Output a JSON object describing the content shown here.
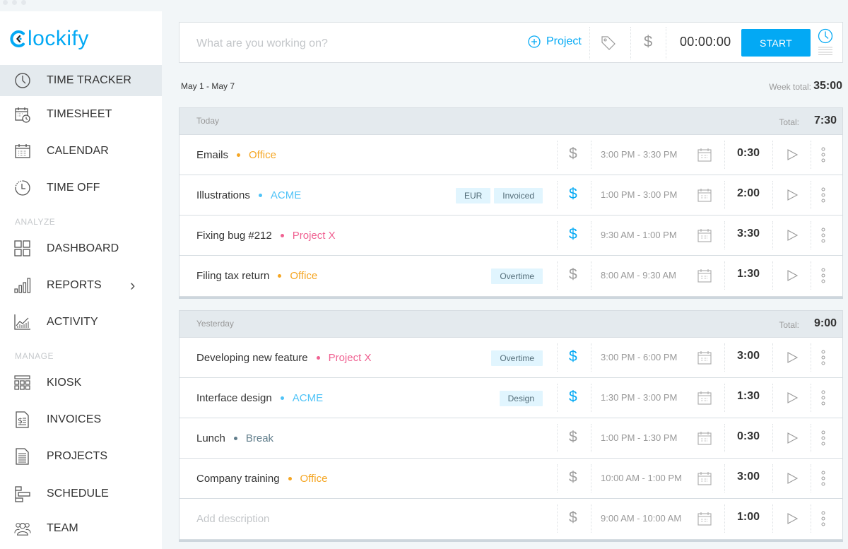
{
  "app": {
    "logo_text": "lockify",
    "brand_color": "#03a9f4"
  },
  "sidebar": {
    "items": [
      {
        "label": "TIME TRACKER",
        "icon": "clock-icon",
        "active": true
      },
      {
        "label": "TIMESHEET",
        "icon": "timesheet-icon"
      },
      {
        "label": "CALENDAR",
        "icon": "calendar-icon"
      },
      {
        "label": "TIME OFF",
        "icon": "time-off-icon"
      },
      {
        "label": "DASHBOARD",
        "icon": "dashboard-icon"
      },
      {
        "label": "REPORTS",
        "icon": "reports-icon",
        "has_submenu": true
      },
      {
        "label": "ACTIVITY",
        "icon": "activity-icon"
      },
      {
        "label": "KIOSK",
        "icon": "kiosk-icon"
      },
      {
        "label": "INVOICES",
        "icon": "invoice-icon"
      },
      {
        "label": "PROJECTS",
        "icon": "projects-icon"
      },
      {
        "label": "SCHEDULE",
        "icon": "schedule-icon"
      },
      {
        "label": "TEAM",
        "icon": "team-icon"
      }
    ],
    "sections": {
      "analyze": "ANALYZE",
      "manage": "MANAGE"
    },
    "reports_chevron": "›"
  },
  "tracker": {
    "placeholder": "What are you working on?",
    "project_label": "Project",
    "timer": "00:00:00",
    "start_label": "START"
  },
  "week": {
    "range": "May 1 - May 7",
    "total_label": "Week total:",
    "total_value": "35:00"
  },
  "colors": {
    "Office": "#f5a623",
    "ACME": "#4fc3f7",
    "Project X": "#f06292",
    "Break": "#607d8b",
    "billable_active": "#03a9f4",
    "billable_inactive": "#9e9e9e"
  },
  "days": [
    {
      "label": "Today",
      "total_label": "Total:",
      "total": "7:30",
      "entries": [
        {
          "description": "Emails",
          "project": "Office",
          "tags": [],
          "billable": false,
          "time_range": "3:00 PM - 3:30 PM",
          "duration": "0:30"
        },
        {
          "description": "Illustrations",
          "project": "ACME",
          "tags": [
            "EUR",
            "Invoiced"
          ],
          "billable": true,
          "time_range": "1:00 PM - 3:00 PM",
          "duration": "2:00"
        },
        {
          "description": "Fixing bug #212",
          "project": "Project X",
          "tags": [],
          "billable": true,
          "time_range": "9:30 AM - 1:00 PM",
          "duration": "3:30"
        },
        {
          "description": "Filing tax return",
          "project": "Office",
          "tags": [
            "Overtime"
          ],
          "billable": false,
          "time_range": "8:00 AM - 9:30 AM",
          "duration": "1:30"
        }
      ]
    },
    {
      "label": "Yesterday",
      "total_label": "Total:",
      "total": "9:00",
      "entries": [
        {
          "description": "Developing new feature",
          "project": "Project X",
          "tags": [
            "Overtime"
          ],
          "billable": true,
          "time_range": "3:00 PM - 6:00 PM",
          "duration": "3:00"
        },
        {
          "description": "Interface design",
          "project": "ACME",
          "tags": [
            "Design"
          ],
          "billable": true,
          "time_range": "1:30 PM - 3:00 PM",
          "duration": "1:30"
        },
        {
          "description": "Lunch",
          "project": "Break",
          "tags": [],
          "billable": false,
          "time_range": "1:00 PM - 1:30 PM",
          "duration": "0:30"
        },
        {
          "description": "Company training",
          "project": "Office",
          "tags": [],
          "billable": false,
          "time_range": "10:00 AM - 1:00 PM",
          "duration": "3:00"
        },
        {
          "description": "",
          "placeholder": "Add description",
          "project": "",
          "tags": [],
          "billable": false,
          "time_range": "9:00 AM - 10:00 AM",
          "duration": "1:00"
        }
      ]
    }
  ]
}
